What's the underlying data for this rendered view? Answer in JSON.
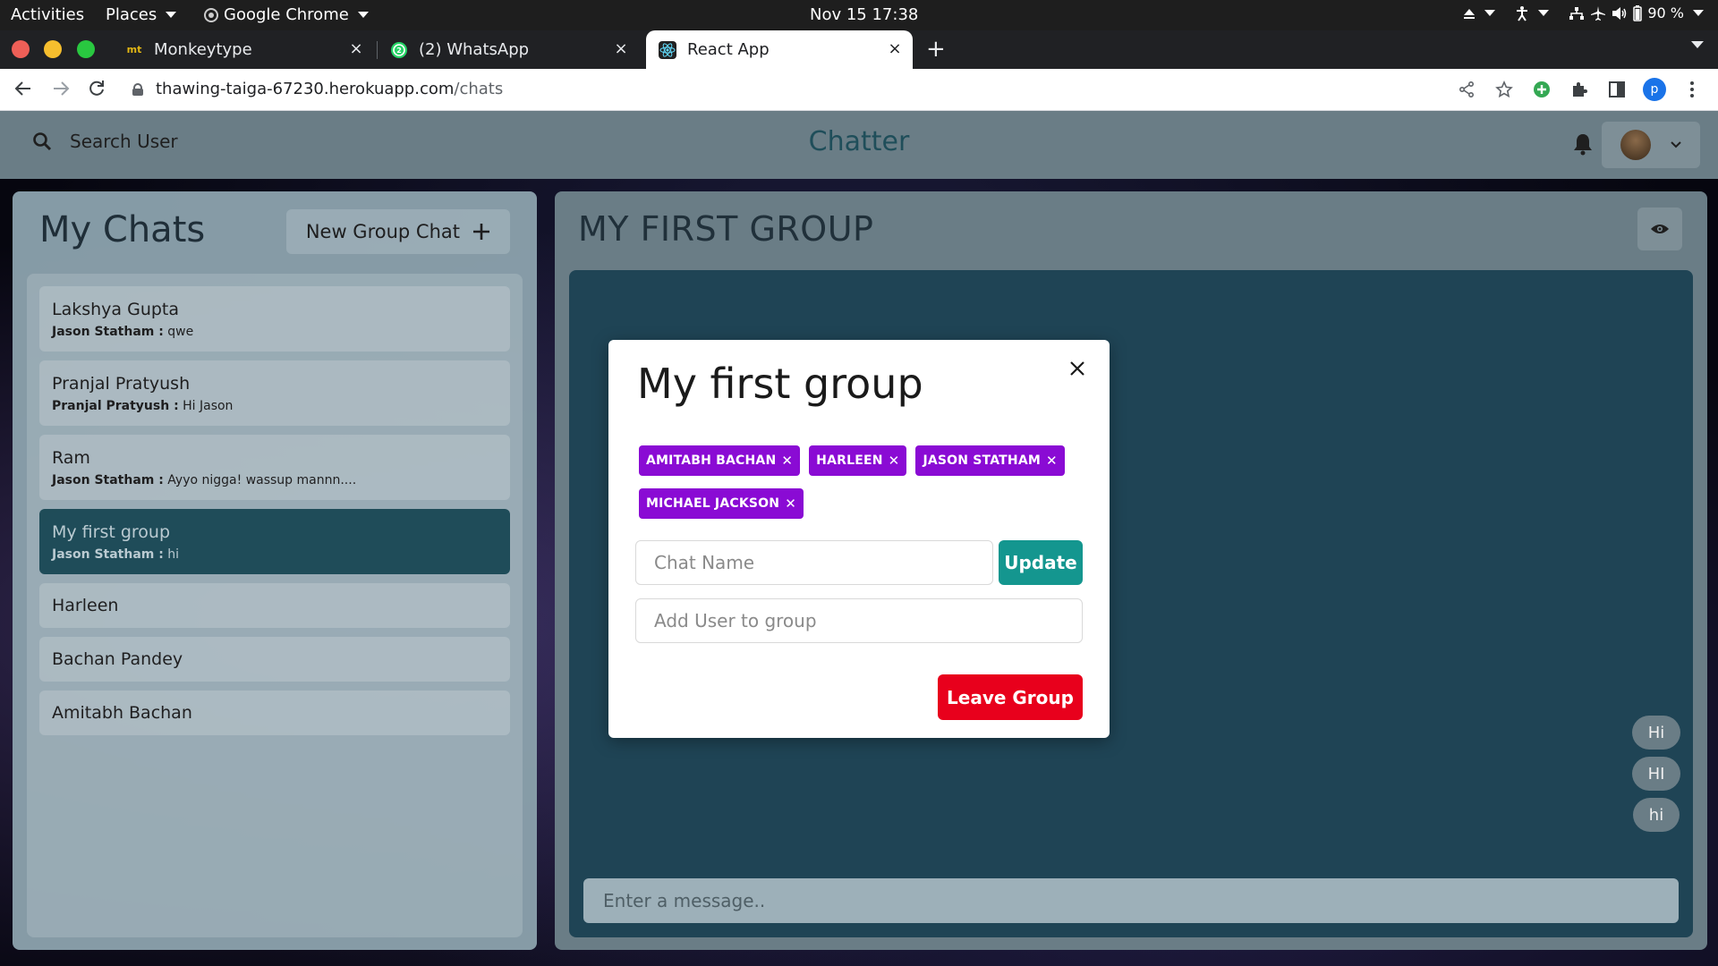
{
  "os_bar": {
    "activities": "Activities",
    "places": "Places",
    "app_name": "Google Chrome",
    "clock": "Nov 15  17:38",
    "battery": "90 %"
  },
  "browser": {
    "tabs": [
      {
        "title": "Monkeytype",
        "favicon": "mt"
      },
      {
        "title": "(2) WhatsApp",
        "favicon": "whatsapp-icon"
      },
      {
        "title": "React App",
        "favicon": "react-icon"
      }
    ],
    "url_host": "thawing-taiga-67230.herokuapp.com",
    "url_path": "/chats",
    "profile_initial": "p"
  },
  "header": {
    "search_label": "Search User",
    "app_title": "Chatter"
  },
  "sidebar": {
    "title": "My Chats",
    "new_group_label": "New Group Chat",
    "chats": [
      {
        "name": "Lakshya Gupta",
        "sender": "Jason Statham :",
        "message": "qwe"
      },
      {
        "name": "Pranjal Pratyush",
        "sender": "Pranjal Pratyush :",
        "message": "Hi Jason"
      },
      {
        "name": "Ram",
        "sender": "Jason Statham :",
        "message": "Ayyo nigga! wassup mannn...."
      },
      {
        "name": "My first group",
        "sender": "Jason Statham :",
        "message": "hi"
      },
      {
        "name": "Harleen"
      },
      {
        "name": "Bachan Pandey"
      },
      {
        "name": "Amitabh Bachan"
      }
    ]
  },
  "chat": {
    "title": "MY FIRST GROUP",
    "messages": [
      "Hi",
      "HI",
      "hi"
    ],
    "input_placeholder": "Enter a message.."
  },
  "modal": {
    "title": "My first group",
    "members": [
      "AMITABH BACHAN",
      "HARLEEN",
      "JASON STATHAM",
      "MICHAEL JACKSON"
    ],
    "chat_name_placeholder": "Chat Name",
    "update_label": "Update",
    "add_user_placeholder": "Add User to group",
    "leave_label": "Leave Group"
  },
  "colors": {
    "accent": "#1f4e5a",
    "badge": "#8a0bd4",
    "update": "#14968f",
    "leave": "#e8001c"
  }
}
